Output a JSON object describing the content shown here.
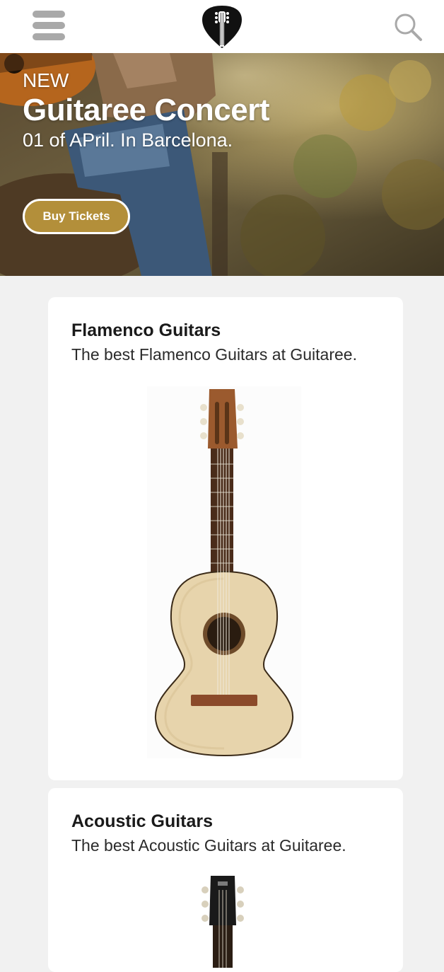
{
  "header": {
    "menu_icon": "hamburger-menu-icon",
    "logo_icon": "guitar-pick-logo",
    "search_icon": "search-icon"
  },
  "hero": {
    "tag": "NEW",
    "title": "Guitaree Concert",
    "subtitle": "01 of APril. In Barcelona.",
    "button_label": "Buy Tickets",
    "accent_color": "#b38f3a"
  },
  "products": [
    {
      "title": "Flamenco Guitars",
      "description": "The best Flamenco Guitars at Guitaree.",
      "image": "classical-guitar-image"
    },
    {
      "title": "Acoustic Guitars",
      "description": "The best Acoustic Guitars at Guitaree.",
      "image": "acoustic-guitar-headstock-image"
    }
  ]
}
